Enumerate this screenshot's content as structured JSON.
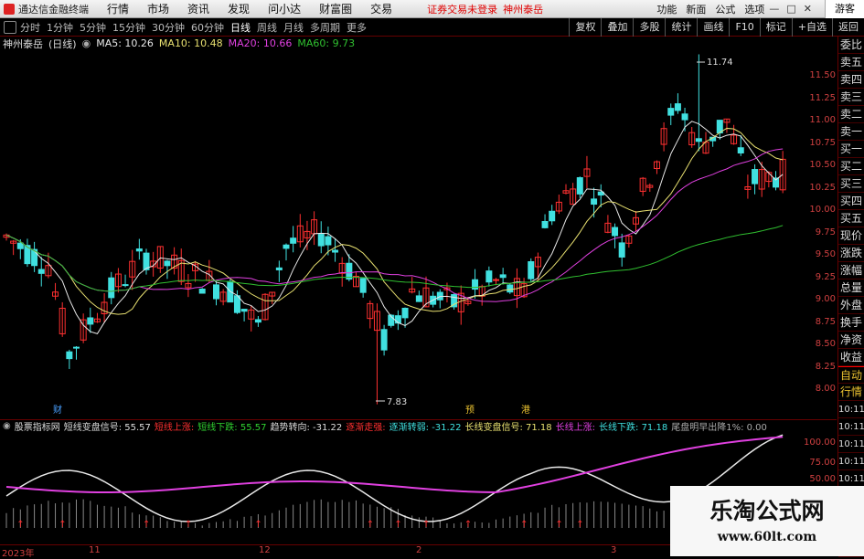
{
  "menubar": {
    "app_title": "通达信金融终端",
    "items": [
      "行情",
      "市场",
      "资讯",
      "发现",
      "问小达",
      "财富圈",
      "交易"
    ],
    "notice": "证券交易未登录",
    "notice_stock": "神州泰岳",
    "right_items": [
      "功能",
      "新面",
      "公式",
      "选项"
    ],
    "user": "游客"
  },
  "periodbar": {
    "periods": [
      "分时",
      "1分钟",
      "5分钟",
      "15分钟",
      "30分钟",
      "60分钟",
      "日线",
      "周线",
      "月线",
      "多周期",
      "更多"
    ],
    "active_period": "日线",
    "tools": [
      "复权",
      "叠加",
      "多股",
      "统计",
      "画线",
      "F10",
      "标记",
      "+自选",
      "返回"
    ]
  },
  "quote": {
    "stock": "神州泰岳",
    "period_tag": "(日线)",
    "ma5": "MA5: 10.26",
    "ma10": "MA10: 10.48",
    "ma20": "MA20: 10.66",
    "ma60": "MA60: 9.73"
  },
  "right_panel": {
    "items": [
      "委比",
      "卖五",
      "卖四",
      "卖三",
      "卖二",
      "卖一",
      "买一",
      "买二",
      "买三",
      "买四",
      "买五",
      "现价",
      "涨跌",
      "涨幅",
      "总量",
      "外盘",
      "换手",
      "净资",
      "收益"
    ],
    "tabs": [
      "自动",
      "行情"
    ],
    "times": [
      "10:11",
      "10:11",
      "10:11",
      "10:11",
      "10:11",
      "10:11",
      "10:11",
      "10:11",
      "10:11"
    ]
  },
  "price_axis": {
    "ticks": [
      "11.50",
      "11.25",
      "11.00",
      "10.75",
      "10.50",
      "10.25",
      "10.00",
      "9.75",
      "9.50",
      "9.25",
      "9.00",
      "8.75",
      "8.50",
      "8.25",
      "8.00"
    ]
  },
  "annotations": {
    "high_label": "11.74",
    "low_label": "7.83",
    "markers": [
      "财",
      "预",
      "港"
    ]
  },
  "indicator": {
    "name": "股票指标网",
    "short_signal": "短线变盘信号: 55.57",
    "short_up": "短线上涨:",
    "short_down": "短线下跌: 55.57",
    "trend_turn": "趋势转向: -31.22",
    "gradual_up": "逐渐走强:",
    "gradual_weak": "逐渐转弱: -31.22",
    "long_signal": "长线变盘信号: 71.18",
    "long_up": "长线上涨:",
    "long_down": "长线下跌: 71.18",
    "warn": "尾盘明早出降1%: 0.00"
  },
  "ind_axis": {
    "ticks": [
      "100.00",
      "75.00",
      "50.00"
    ]
  },
  "date_axis": {
    "labels": [
      "2023年",
      "11",
      "12",
      "2",
      "3"
    ]
  },
  "watermark": {
    "title": "乐淘公式网",
    "url": "www.60lt.com"
  },
  "colors": {
    "up": "#ff3030",
    "down": "#40e0e0",
    "ma5": "#e8e8e8",
    "ma10": "#e8e070",
    "ma20": "#e040e0",
    "ma60": "#30c030"
  }
}
